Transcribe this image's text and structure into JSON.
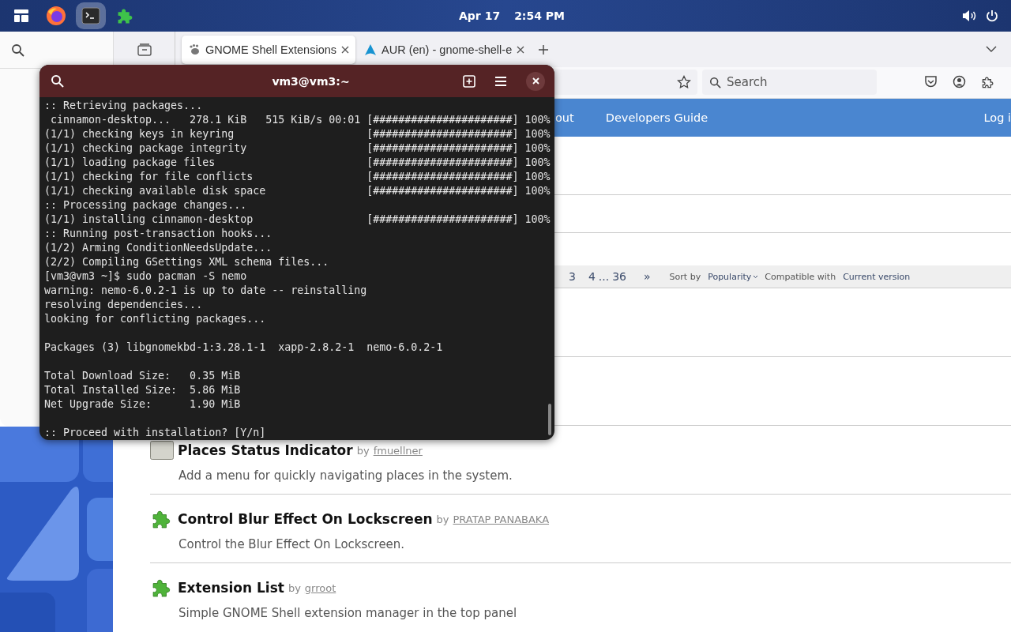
{
  "top_bar": {
    "date": "Apr 17",
    "time": "2:54 PM",
    "dock": [
      {
        "kind": "activities",
        "selected": false
      },
      {
        "kind": "firefox",
        "selected": false
      },
      {
        "kind": "terminal",
        "selected": true
      },
      {
        "kind": "extensions",
        "selected": false
      }
    ]
  },
  "browser": {
    "tabs": [
      {
        "title": "GNOME Shell Extensions",
        "kind": "gnome",
        "selected": true
      },
      {
        "title": "AUR (en) - gnome-shell-e",
        "kind": "arch",
        "selected": false
      }
    ],
    "search": {
      "placeholder": "Search"
    },
    "nav": [
      "out",
      "Developers Guide",
      "Log i"
    ],
    "pagination": {
      "pages": [
        "3",
        "4"
      ],
      "ellipsis": "...",
      "last": "36",
      "next": "»"
    },
    "sort": {
      "label": "Sort by",
      "value": "Popularity",
      "compat_label": "Compatible with",
      "compat_value": "Current version"
    },
    "extensions": [
      {
        "name": "Places Status Indicator",
        "by": "by",
        "author": "fmuellner",
        "description": "Add a menu for quickly navigating places in the system.",
        "kind": "placeholder"
      },
      {
        "name": "Control Blur Effect On Lockscreen",
        "by": "by",
        "author": "PRATAP PANABAKA",
        "description": "Control the Blur Effect On Lockscreen.",
        "kind": "puzzle"
      },
      {
        "name": "Extension List",
        "by": "by",
        "author": "grroot",
        "description": "Simple GNOME Shell extension manager in the top panel",
        "kind": "puzzle"
      }
    ]
  },
  "terminal": {
    "title": "vm3@vm3:~",
    "blocks": [
      [
        ":: Retrieving packages...",
        " cinnamon-desktop...   278.1 KiB   515 KiB/s 00:01 [######################] 100%",
        "(1/1) checking keys in keyring                     [######################] 100%",
        "(1/1) checking package integrity                   [######################] 100%",
        "(1/1) loading package files                        [######################] 100%",
        "(1/1) checking for file conflicts                  [######################] 100%",
        "(1/1) checking available disk space                [######################] 100%",
        ":: Processing package changes...",
        "(1/1) installing cinnamon-desktop                  [######################] 100%",
        ":: Running post-transaction hooks...",
        "(1/2) Arming ConditionNeedsUpdate...",
        "(2/2) Compiling GSettings XML schema files...",
        "[vm3@vm3 ~]$ sudo pacman -S nemo",
        "warning: nemo-6.0.2-1 is up to date -- reinstalling",
        "resolving dependencies...",
        "looking for conflicting packages..."
      ],
      [
        "Packages (3) libgnomekbd-1:3.28.1-1  xapp-2.8.2-1  nemo-6.0.2-1"
      ],
      [
        "Total Download Size:   0.35 MiB",
        "Total Installed Size:  5.86 MiB",
        "Net Upgrade Size:      1.90 MiB"
      ],
      [
        ":: Proceed with installation? [Y/n]"
      ]
    ]
  }
}
